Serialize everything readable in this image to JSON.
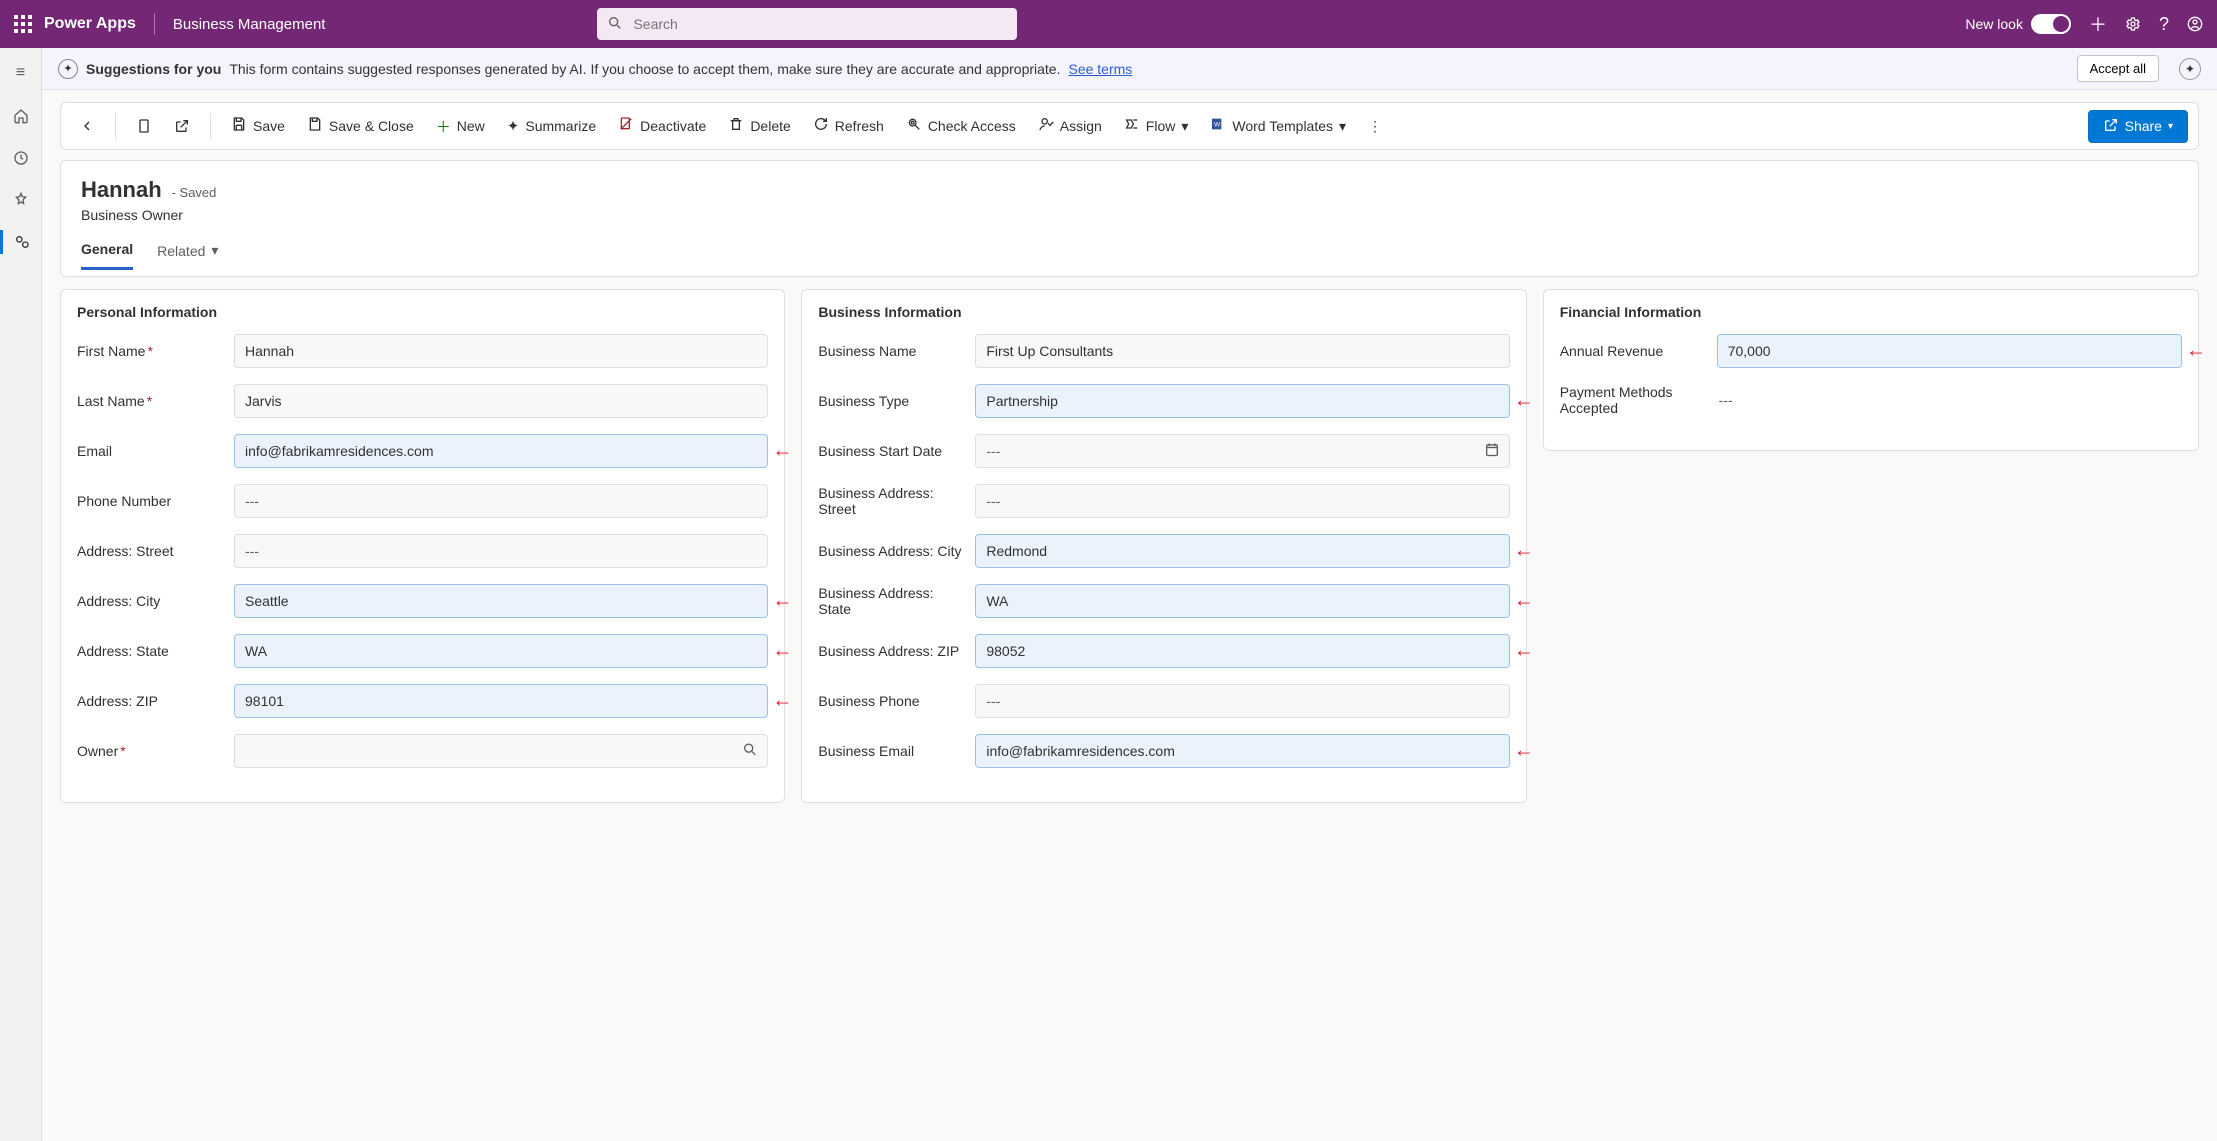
{
  "header": {
    "brand": "Power Apps",
    "app": "Business Management",
    "search_placeholder": "Search",
    "new_look_label": "New look"
  },
  "suggestion_bar": {
    "lead": "Suggestions for you",
    "body": "This form contains suggested responses generated by AI. If you choose to accept them, make sure they are accurate and appropriate.",
    "see_terms": "See terms",
    "accept_all": "Accept all"
  },
  "commands": {
    "back": "Back",
    "save": "Save",
    "save_close": "Save & Close",
    "new": "New",
    "summarize": "Summarize",
    "deactivate": "Deactivate",
    "delete": "Delete",
    "refresh": "Refresh",
    "check_access": "Check Access",
    "assign": "Assign",
    "flow": "Flow",
    "word_templates": "Word Templates",
    "share": "Share"
  },
  "record": {
    "title": "Hannah",
    "saved_suffix": "- Saved",
    "entity": "Business Owner",
    "tabs": {
      "general": "General",
      "related": "Related"
    }
  },
  "sections": {
    "personal": {
      "title": "Personal Information",
      "fields": {
        "first_name_label": "First Name",
        "first_name_value": "Hannah",
        "last_name_label": "Last Name",
        "last_name_value": "Jarvis",
        "email_label": "Email",
        "email_value": "info@fabrikamresidences.com",
        "phone_label": "Phone Number",
        "phone_value": "---",
        "addr_street_label": "Address: Street",
        "addr_street_value": "---",
        "addr_city_label": "Address: City",
        "addr_city_value": "Seattle",
        "addr_state_label": "Address: State",
        "addr_state_value": "WA",
        "addr_zip_label": "Address: ZIP",
        "addr_zip_value": "98101",
        "owner_label": "Owner",
        "owner_value": ""
      }
    },
    "business": {
      "title": "Business Information",
      "fields": {
        "name_label": "Business Name",
        "name_value": "First Up Consultants",
        "type_label": "Business Type",
        "type_value": "Partnership",
        "start_label": "Business Start Date",
        "start_value": "---",
        "addr_street_label": "Business Address: Street",
        "addr_street_value": "---",
        "addr_city_label": "Business Address: City",
        "addr_city_value": "Redmond",
        "addr_state_label": "Business Address: State",
        "addr_state_value": "WA",
        "addr_zip_label": "Business Address: ZIP",
        "addr_zip_value": "98052",
        "phone_label": "Business Phone",
        "phone_value": "---",
        "email_label": "Business Email",
        "email_value": "info@fabrikamresidences.com"
      }
    },
    "financial": {
      "title": "Financial Information",
      "fields": {
        "annual_rev_label": "Annual Revenue",
        "annual_rev_value": "70,000",
        "payment_label": "Payment Methods Accepted",
        "payment_value": "---"
      }
    }
  }
}
